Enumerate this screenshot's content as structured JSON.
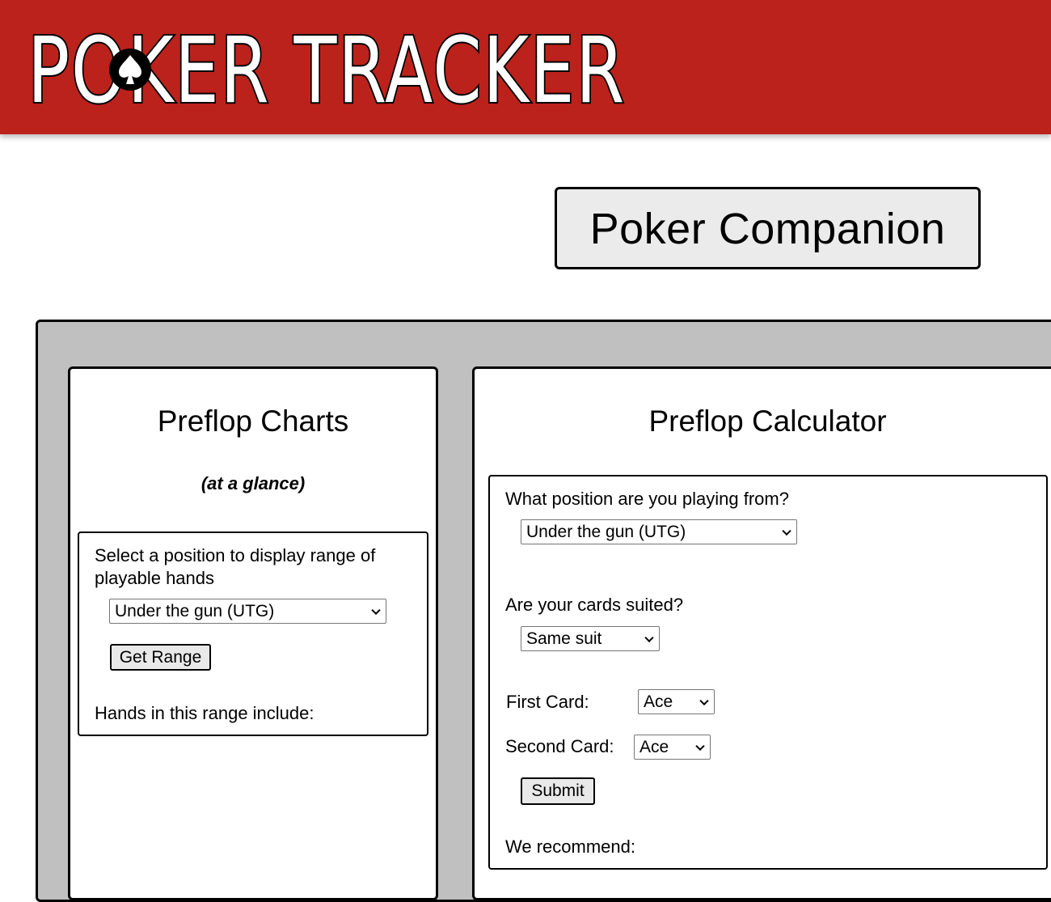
{
  "header": {
    "logo_text": "POKER TRACKER",
    "brand_color": "#bb221b"
  },
  "title": "Poker Companion",
  "charts": {
    "title": "Preflop Charts",
    "subtitle": "(at a glance)",
    "prompt": "Select a position to display range of playable hands",
    "position_select": "Under the gun (UTG)",
    "button_label": "Get Range",
    "result_label": "Hands in this range include:"
  },
  "calculator": {
    "title": "Preflop Calculator",
    "position_question": "What position are you playing from?",
    "position_select": "Under the gun (UTG)",
    "suited_question": "Are your cards suited?",
    "suited_select": "Same suit",
    "first_card_label": "First Card:",
    "first_card_select": "Ace",
    "second_card_label": "Second Card:",
    "second_card_select": "Ace",
    "button_label": "Submit",
    "result_label": "We recommend:"
  }
}
